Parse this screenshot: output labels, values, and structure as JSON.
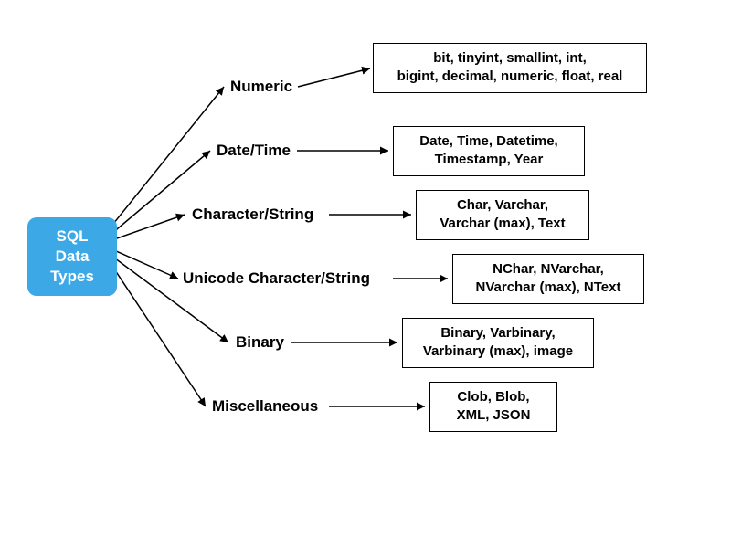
{
  "root": {
    "label": "SQL Data\nTypes"
  },
  "categories": [
    {
      "label": "Numeric",
      "detail": "bit, tinyint, smallint, int,\nbigint, decimal, numeric, float, real"
    },
    {
      "label": "Date/Time",
      "detail": "Date, Time, Datetime,\nTimestamp, Year"
    },
    {
      "label": "Character/String",
      "detail": "Char, Varchar,\nVarchar (max), Text"
    },
    {
      "label": "Unicode Character/String",
      "detail": "NChar, NVarchar,\nNVarchar (max), NText"
    },
    {
      "label": "Binary",
      "detail": "Binary, Varbinary,\nVarbinary (max), image"
    },
    {
      "label": "Miscellaneous",
      "detail": "Clob, Blob,\nXML, JSON"
    }
  ]
}
